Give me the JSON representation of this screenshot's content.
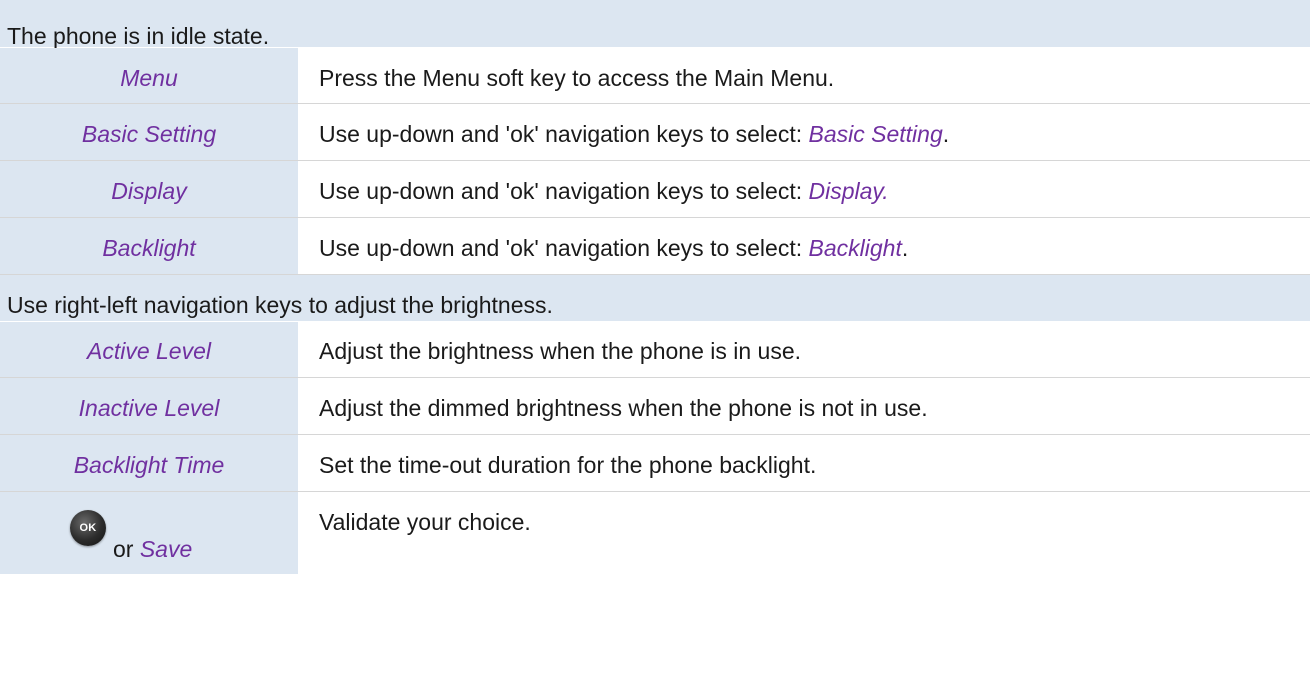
{
  "intro": "The phone is in idle state.",
  "navigation_steps": [
    {
      "key": "Menu",
      "description": "Press the Menu soft key to access the Main Menu."
    },
    {
      "key": "Basic Setting",
      "description_prefix": "Use up-down and 'ok' navigation keys to select: ",
      "description_target": "Basic Setting",
      "description_suffix": "."
    },
    {
      "key": "Display",
      "description_prefix": "Use up-down and 'ok' navigation keys to select: ",
      "description_target": "Display.",
      "description_suffix": ""
    },
    {
      "key": "Backlight",
      "description_prefix": "Use up-down and 'ok' navigation keys to select: ",
      "description_target": "Backlight",
      "description_suffix": "."
    }
  ],
  "adjust_intro": "Use right-left navigation keys to adjust the brightness.",
  "settings": [
    {
      "key": "Active Level",
      "description": "Adjust the brightness when the phone is in use."
    },
    {
      "key": "Inactive Level",
      "description": "Adjust the dimmed brightness when the phone is not in use."
    },
    {
      "key": "Backlight Time",
      "description": "Set the time-out duration for the phone backlight."
    }
  ],
  "validate": {
    "ok_key_label": "OK",
    "or_text": "or",
    "save_label": "Save",
    "description": "Validate your choice."
  },
  "colors": {
    "key_background": "#dce6f1",
    "key_text": "#7030a0",
    "body_text": "#1a1a1a"
  },
  "icons": {
    "ok_key": "ok-key-icon"
  }
}
